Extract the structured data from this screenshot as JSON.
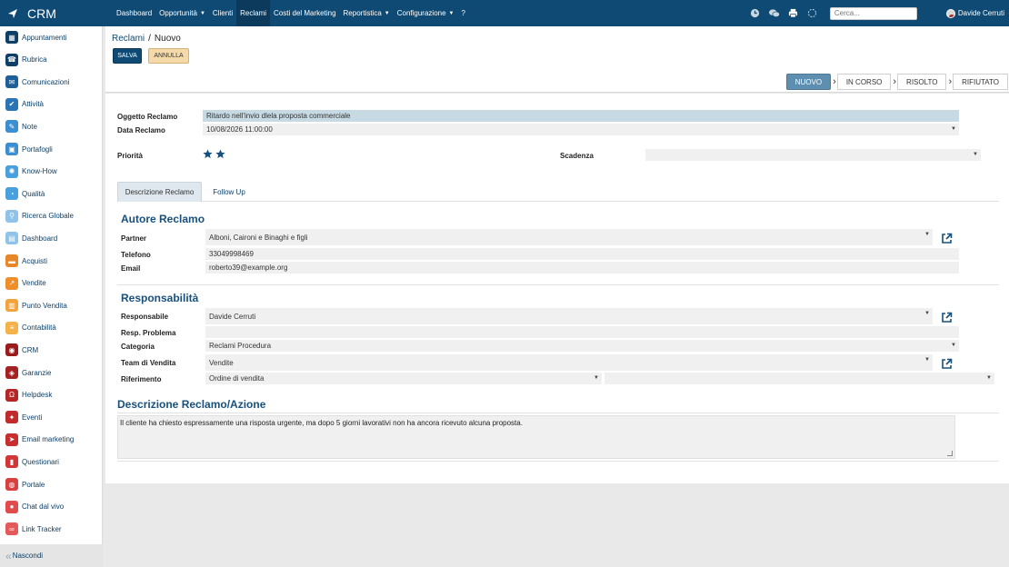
{
  "app": {
    "title": "CRM"
  },
  "topmenu": [
    {
      "label": "Dashboard",
      "caret": false,
      "active": false
    },
    {
      "label": "Opportunità",
      "caret": true,
      "active": false
    },
    {
      "label": "Clienti",
      "caret": false,
      "active": false
    },
    {
      "label": "Reclami",
      "caret": false,
      "active": true
    },
    {
      "label": "Costi del Marketing",
      "caret": false,
      "active": false
    },
    {
      "label": "Reportistica",
      "caret": true,
      "active": false
    },
    {
      "label": "Configurazione",
      "caret": true,
      "active": false
    },
    {
      "label": "?",
      "caret": false,
      "active": false
    }
  ],
  "topbar": {
    "search_placeholder": "Cerca...",
    "user_name": "Davide Cerruti"
  },
  "sidebar": {
    "items": [
      {
        "label": "Appuntamenti",
        "icon": "calendar-icon",
        "color": "#0e3f66"
      },
      {
        "label": "Rubrica",
        "icon": "address-book-icon",
        "color": "#0e3f66"
      },
      {
        "label": "Comunicazioni",
        "icon": "chat-icon",
        "color": "#1c5f99"
      },
      {
        "label": "Attività",
        "icon": "checkbox-icon",
        "color": "#2a73b5"
      },
      {
        "label": "Note",
        "icon": "note-icon",
        "color": "#3b8ed0"
      },
      {
        "label": "Portafogli",
        "icon": "lock-icon",
        "color": "#3b8ed0"
      },
      {
        "label": "Know-How",
        "icon": "bulb-icon",
        "color": "#4aa0dd"
      },
      {
        "label": "Qualità",
        "icon": "gauge-icon",
        "color": "#4aa0dd"
      },
      {
        "label": "Ricerca Globale",
        "icon": "search-icon",
        "color": "#8fc3ea"
      },
      {
        "label": "Dashboard",
        "icon": "dashboard-icon",
        "color": "#8fc3ea"
      },
      {
        "label": "Acquisti",
        "icon": "cart-icon",
        "color": "#e8872a"
      },
      {
        "label": "Vendite",
        "icon": "chart-icon",
        "color": "#ef8f2c"
      },
      {
        "label": "Punto Vendita",
        "icon": "shop-icon",
        "color": "#f3a33c"
      },
      {
        "label": "Contabilità",
        "icon": "ledger-icon",
        "color": "#f4b24a"
      },
      {
        "label": "CRM",
        "icon": "eye-icon",
        "color": "#9b1c1c"
      },
      {
        "label": "Garanzie",
        "icon": "shield-icon",
        "color": "#a52222"
      },
      {
        "label": "Helpdesk",
        "icon": "headset-icon",
        "color": "#b52626"
      },
      {
        "label": "Eventi",
        "icon": "ticket-icon",
        "color": "#c22b2b"
      },
      {
        "label": "Email marketing",
        "icon": "send-icon",
        "color": "#c92e2e"
      },
      {
        "label": "Questionari",
        "icon": "clipboard-icon",
        "color": "#d33636"
      },
      {
        "label": "Portale",
        "icon": "globe-icon",
        "color": "#d94040"
      },
      {
        "label": "Chat dal vivo",
        "icon": "chat-bubble-icon",
        "color": "#e14b4b"
      },
      {
        "label": "Link Tracker",
        "icon": "link-icon",
        "color": "#e45a5a"
      }
    ],
    "hide_label": "Nascondi"
  },
  "breadcrumb": {
    "parent": "Reclami",
    "separator": "/",
    "current": "Nuovo"
  },
  "actions": {
    "save": "SALVA",
    "cancel": "ANNULLA"
  },
  "status": [
    {
      "label": "NUOVO",
      "active": true
    },
    {
      "label": "IN CORSO",
      "active": false
    },
    {
      "label": "RISOLTO",
      "active": false
    },
    {
      "label": "RIFIUTATO",
      "active": false
    }
  ],
  "form": {
    "oggetto_label": "Oggetto Reclamo",
    "oggetto_value": "Ritardo nell'invio dlela proposta commerciale",
    "data_label": "Data Reclamo",
    "data_value": "10/08/2026 11:00:00",
    "priorita_label": "Priorità",
    "priorita_stars": 2,
    "scadenza_label": "Scadenza",
    "scadenza_value": ""
  },
  "tabs": [
    {
      "label": "Descrizione Reclamo",
      "active": true
    },
    {
      "label": "Follow Up",
      "active": false
    }
  ],
  "autore": {
    "title": "Autore Reclamo",
    "partner_label": "Partner",
    "partner_value": "Alboni, Caironi e Binaghi e figli",
    "telefono_label": "Telefono",
    "telefono_value": "33049998469",
    "email_label": "Email",
    "email_value": "roberto39@example.org"
  },
  "responsabilita": {
    "title": "Responsabilità",
    "responsabile_label": "Responsabile",
    "responsabile_value": "Davide Cerruti",
    "resp_problema_label": "Resp. Problema",
    "resp_problema_value": "",
    "categoria_label": "Categoria",
    "categoria_value": "Reclami Procedura",
    "team_label": "Team di Vendita",
    "team_value": "Vendite",
    "riferimento_label": "Riferimento",
    "riferimento_value": "Ordine di vendita",
    "riferimento_value2": ""
  },
  "descrizione": {
    "title": "Descrizione Reclamo/Azione",
    "text": "Il cliente ha chiesto espressamente una risposta urgente, ma dopo 5 giorni lavorativi non ha ancora ricevuto alcuna proposta."
  },
  "colors": {
    "topbar": "#0e4a74",
    "accent": "#17507c",
    "status_active": "#5f8fb0",
    "cancel_button": "#f6d9a9",
    "highlight_field": "#c7d9e3"
  }
}
